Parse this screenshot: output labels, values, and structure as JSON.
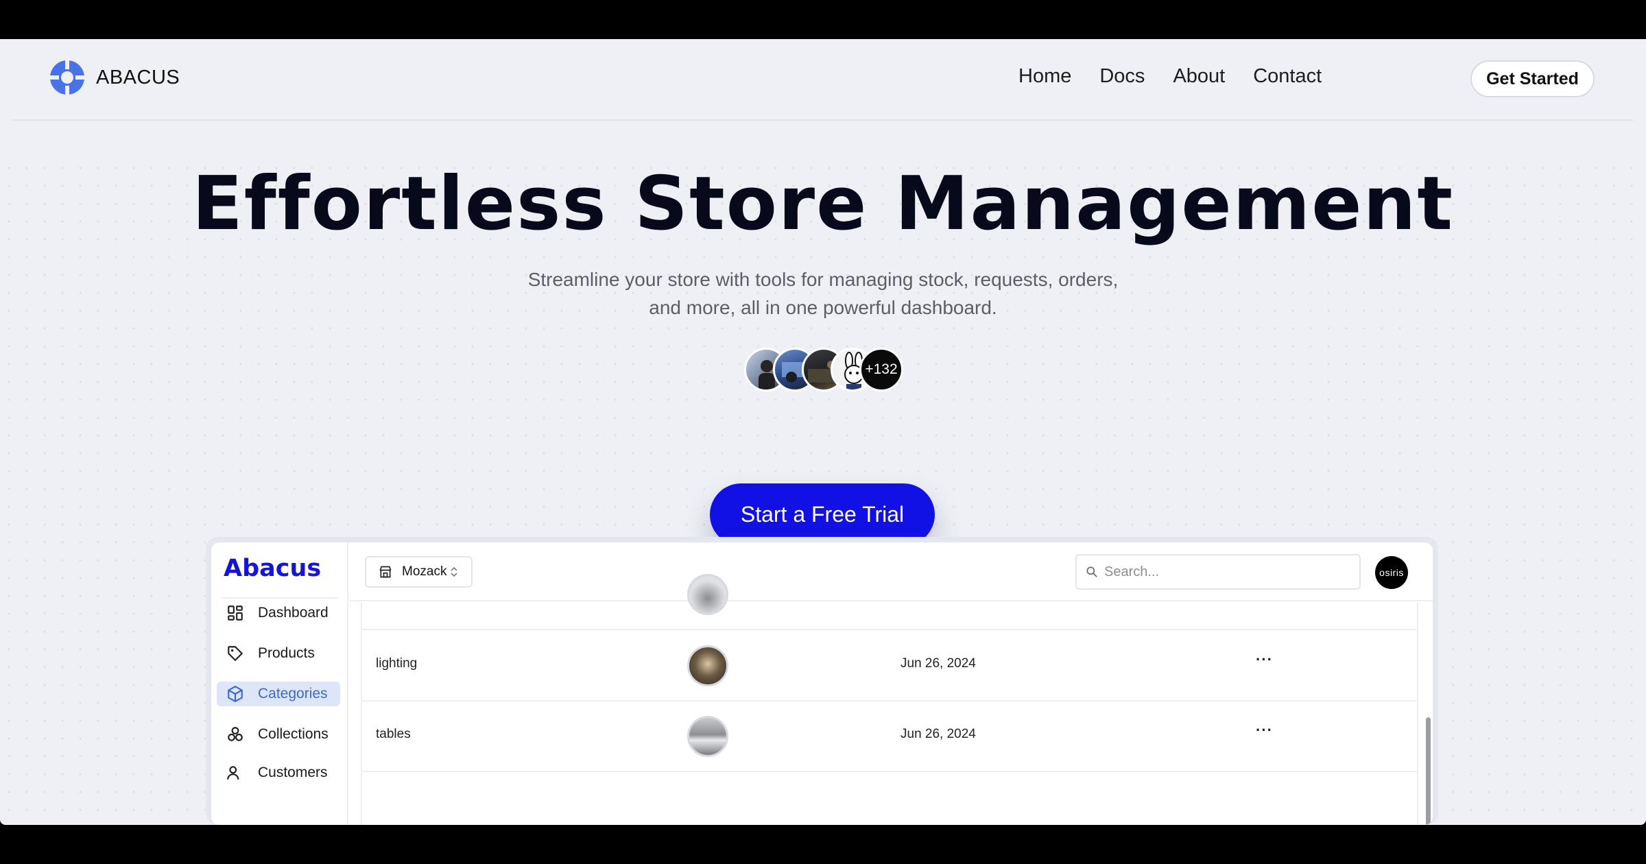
{
  "nav": {
    "brand": "ABACUS",
    "links": [
      "Home",
      "Docs",
      "About",
      "Contact"
    ],
    "cta": "Get Started"
  },
  "hero": {
    "title": "Effortless Store Management",
    "subtitle_line1": "Streamline your store with tools for managing stock, requests, orders,",
    "subtitle_line2": "and more, all in one powerful dashboard.",
    "avatar_count": "+132",
    "cta": "Start a Free Trial"
  },
  "dashboard": {
    "brand": "Abacus",
    "sidebar": [
      {
        "label": "Dashboard",
        "icon": "grid-icon"
      },
      {
        "label": "Products",
        "icon": "tag-icon"
      },
      {
        "label": "Categories",
        "icon": "box-icon",
        "active": true
      },
      {
        "label": "Collections",
        "icon": "collections-icon"
      },
      {
        "label": "Customers",
        "icon": "users-icon"
      }
    ],
    "store": "Mozack",
    "search_placeholder": "Search...",
    "user": "osiris",
    "rows": [
      {
        "name": "lighting",
        "date": "Jun 26, 2024",
        "more": "···"
      },
      {
        "name": "tables",
        "date": "Jun 26, 2024",
        "more": "···"
      }
    ]
  },
  "colors": {
    "accent": "#1111e6",
    "brand_blue": "#1515d8",
    "logo_blue": "#4a72e8",
    "active_bg": "#dde6f8",
    "page_bg": "#eef0f5"
  }
}
